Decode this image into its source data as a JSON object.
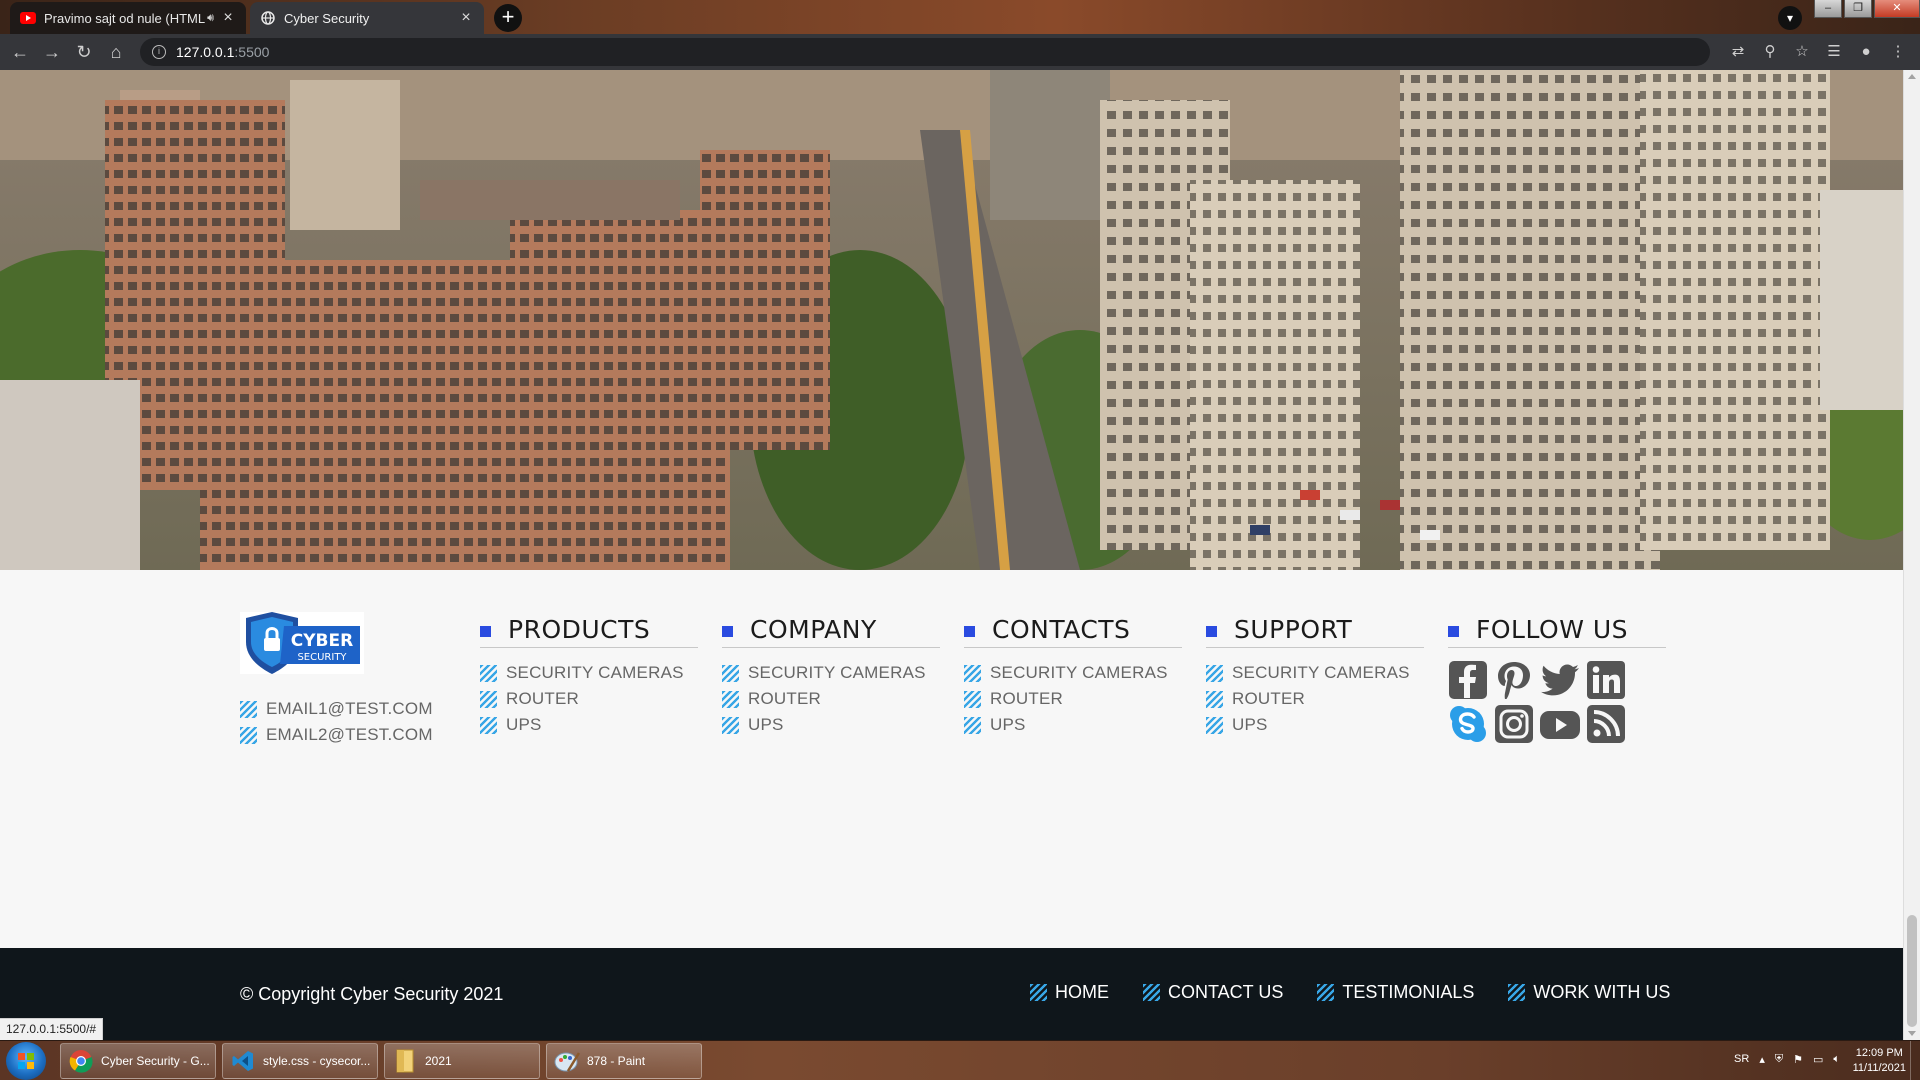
{
  "browser": {
    "tabs": [
      {
        "title": "Pravimo sajt od nule (HTML",
        "active": false
      },
      {
        "title": "Cyber Security",
        "active": true
      }
    ],
    "url_host": "127.0.0.1",
    "url_port": ":5500",
    "status_url": "127.0.0.1:5500/#"
  },
  "colors": {
    "accent_blue": "#2a4be0",
    "stripe_blue": "#38a6e6",
    "footer_dark": "#0f161b",
    "page_bg": "#f7f7f7"
  },
  "footer": {
    "logo_line1": "CYBER",
    "logo_line2": "SECURITY",
    "emails": [
      "EMAIL1@TEST.COM",
      "EMAIL2@TEST.COM"
    ],
    "columns": [
      {
        "heading": "PRODUCTS",
        "items": [
          "SECURITY CAMERAS",
          "ROUTER",
          "UPS"
        ]
      },
      {
        "heading": "COMPANY",
        "items": [
          "SECURITY CAMERAS",
          "ROUTER",
          "UPS"
        ]
      },
      {
        "heading": "CONTACTS",
        "items": [
          "SECURITY CAMERAS",
          "ROUTER",
          "UPS"
        ]
      },
      {
        "heading": "SUPPORT",
        "items": [
          "SECURITY CAMERAS",
          "ROUTER",
          "UPS"
        ]
      }
    ],
    "follow_heading": "FOLLOW US",
    "social_icons": [
      "facebook-icon",
      "pinterest-icon",
      "twitter-icon",
      "linkedin-icon",
      "skype-icon",
      "instagram-icon",
      "youtube-icon",
      "rss-icon"
    ],
    "copyright": "© Copyright Cyber Security 2021",
    "bottom_nav": [
      "HOME",
      "CONTACT US",
      "TESTIMONIALS",
      "WORK WITH US"
    ]
  },
  "taskbar": {
    "items": [
      {
        "label": "Cyber Security - G...",
        "icon": "chrome-icon"
      },
      {
        "label": "style.css - cysecor...",
        "icon": "vscode-icon"
      },
      {
        "label": "2021",
        "icon": "folder-icon"
      },
      {
        "label": "878 - Paint",
        "icon": "paint-icon"
      }
    ],
    "lang": "SR",
    "time": "12:09 PM",
    "date": "11/11/2021"
  }
}
